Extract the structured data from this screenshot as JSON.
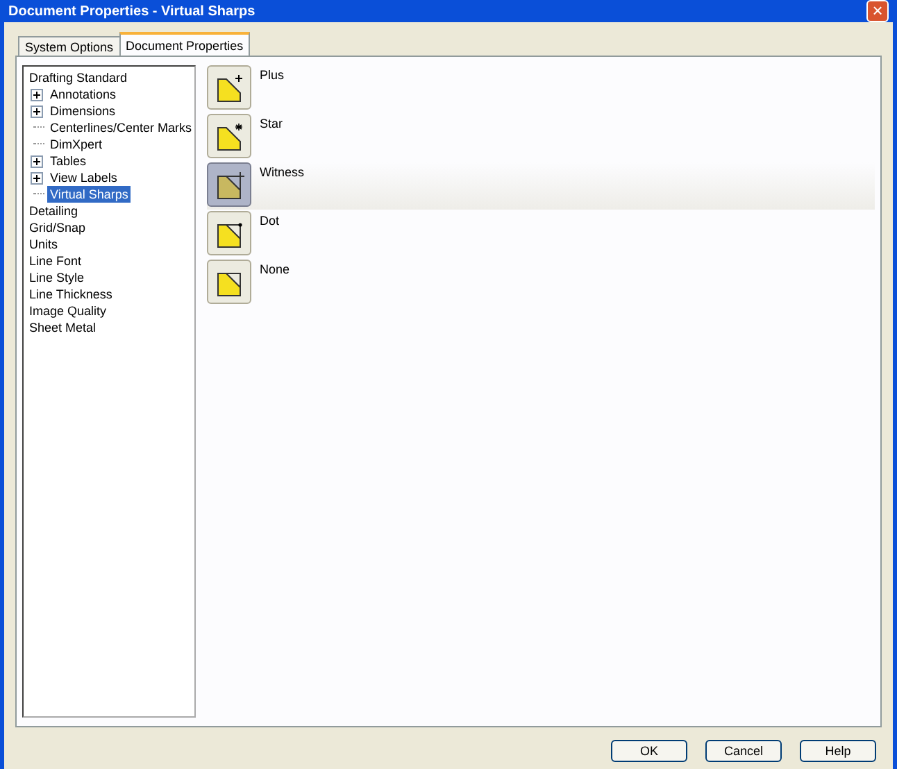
{
  "window": {
    "title": "Document Properties - Virtual Sharps",
    "close_label": "×"
  },
  "tabs": [
    {
      "label": "System Options",
      "selected": false
    },
    {
      "label": "Document Properties",
      "selected": true
    }
  ],
  "tree": [
    {
      "label": "Drafting Standard",
      "selected": false,
      "children": [
        {
          "label": "Annotations",
          "expandable": true,
          "selected": false
        },
        {
          "label": "Dimensions",
          "expandable": true,
          "selected": false
        },
        {
          "label": "Centerlines/Center Marks",
          "expandable": false,
          "selected": false
        },
        {
          "label": "DimXpert",
          "expandable": false,
          "selected": false
        },
        {
          "label": "Tables",
          "expandable": true,
          "selected": false
        },
        {
          "label": "View Labels",
          "expandable": true,
          "selected": false
        },
        {
          "label": "Virtual Sharps",
          "expandable": false,
          "selected": true
        }
      ]
    },
    {
      "label": "Detailing",
      "selected": false
    },
    {
      "label": "Grid/Snap",
      "selected": false
    },
    {
      "label": "Units",
      "selected": false
    },
    {
      "label": "Line Font",
      "selected": false
    },
    {
      "label": "Line Style",
      "selected": false
    },
    {
      "label": "Line Thickness",
      "selected": false
    },
    {
      "label": "Image Quality",
      "selected": false
    },
    {
      "label": "Sheet Metal",
      "selected": false
    }
  ],
  "options": [
    {
      "kind": "plus",
      "label": "Plus",
      "selected": false
    },
    {
      "kind": "star",
      "label": "Star",
      "selected": false
    },
    {
      "kind": "witness",
      "label": "Witness",
      "selected": true
    },
    {
      "kind": "dot",
      "label": "Dot",
      "selected": false
    },
    {
      "kind": "none",
      "label": "None",
      "selected": false
    }
  ],
  "buttons": [
    "OK",
    "Cancel",
    "Help"
  ]
}
